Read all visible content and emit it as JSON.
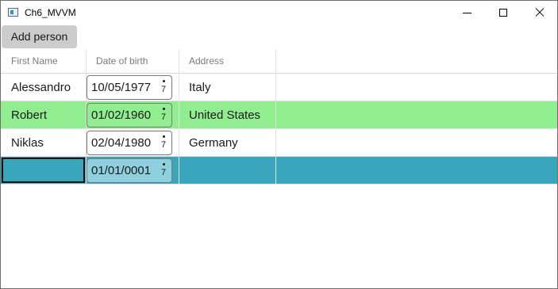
{
  "window": {
    "title": "Ch6_MVVM"
  },
  "toolbar": {
    "add_label": "Add person"
  },
  "grid": {
    "columns": [
      "First Name",
      "Date of birth",
      "Address"
    ],
    "rows": [
      {
        "first_name": "Alessandro",
        "dob": "10/05/1977",
        "address": "Italy",
        "bg": "#ffffff"
      },
      {
        "first_name": "Robert",
        "dob": "01/02/1960",
        "address": "United States",
        "bg": "#90ee90"
      },
      {
        "first_name": "Niklas",
        "dob": "02/04/1980",
        "address": "Germany",
        "bg": "#ffffff"
      },
      {
        "first_name": "",
        "dob": "01/01/0001",
        "address": "",
        "bg": "#3aa6bc"
      }
    ],
    "calendar_glyph": "7"
  },
  "colors": {
    "selected_row": "#3aa6bc",
    "highlight_row": "#90ee90",
    "button_bg": "#cccccc"
  }
}
